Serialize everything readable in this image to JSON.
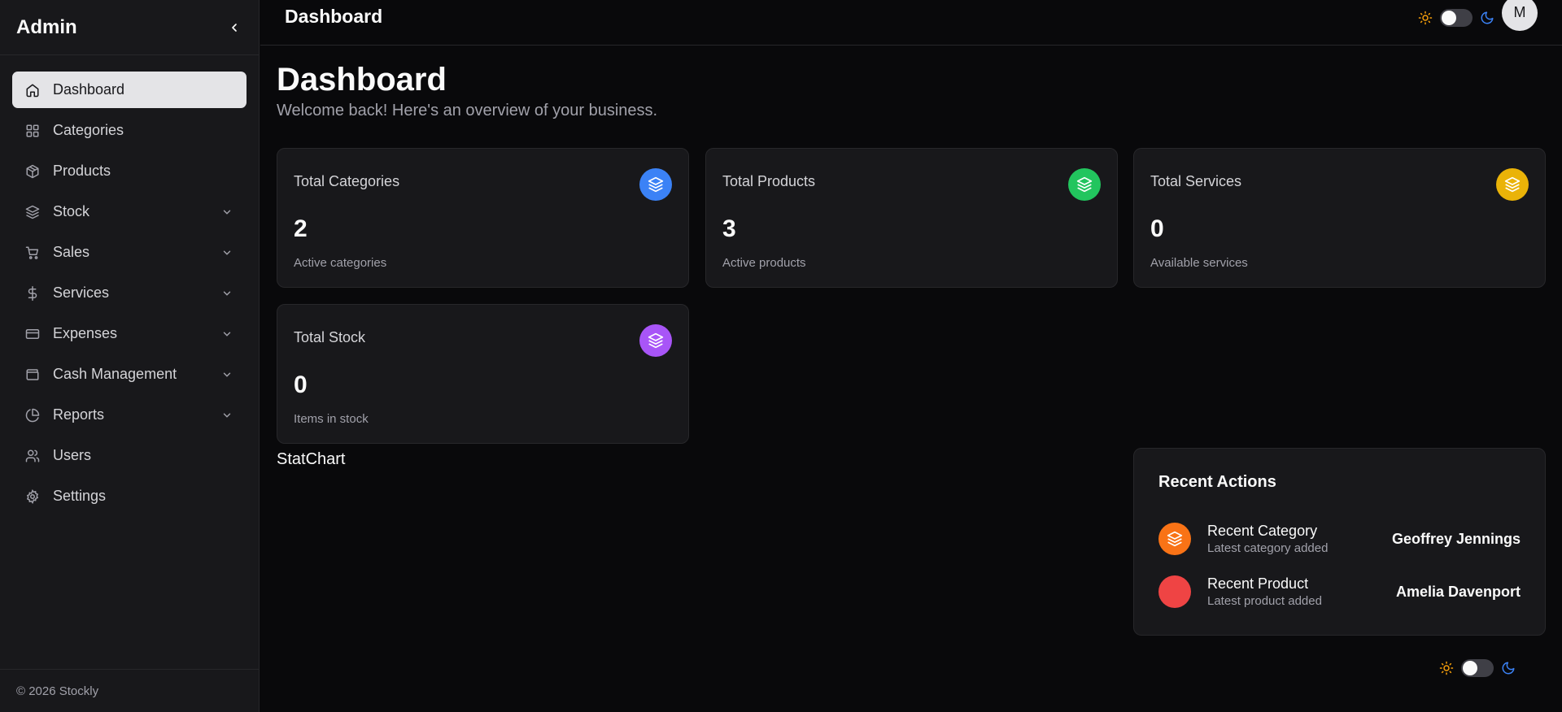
{
  "sidebar": {
    "title": "Admin",
    "items": [
      {
        "label": "Dashboard",
        "icon": "home-icon",
        "active": true,
        "expandable": false
      },
      {
        "label": "Categories",
        "icon": "grid-icon",
        "active": false,
        "expandable": false
      },
      {
        "label": "Products",
        "icon": "package-icon",
        "active": false,
        "expandable": false
      },
      {
        "label": "Stock",
        "icon": "layers-icon",
        "active": false,
        "expandable": true
      },
      {
        "label": "Sales",
        "icon": "cart-icon",
        "active": false,
        "expandable": true
      },
      {
        "label": "Services",
        "icon": "dollar-icon",
        "active": false,
        "expandable": true
      },
      {
        "label": "Expenses",
        "icon": "credit-card-icon",
        "active": false,
        "expandable": true
      },
      {
        "label": "Cash Management",
        "icon": "wallet-icon",
        "active": false,
        "expandable": true
      },
      {
        "label": "Reports",
        "icon": "pie-chart-icon",
        "active": false,
        "expandable": true
      },
      {
        "label": "Users",
        "icon": "users-icon",
        "active": false,
        "expandable": false
      },
      {
        "label": "Settings",
        "icon": "gear-icon",
        "active": false,
        "expandable": false
      }
    ],
    "footer": "© 2026 Stockly"
  },
  "header": {
    "title": "Dashboard",
    "avatar_initial": "M"
  },
  "main": {
    "heading": "Dashboard",
    "subheading": "Welcome back! Here's an overview of your business.",
    "cards": [
      {
        "title": "Total Categories",
        "value": "2",
        "desc": "Active categories",
        "color": "#3b82f6"
      },
      {
        "title": "Total Products",
        "value": "3",
        "desc": "Active products",
        "color": "#22c55e"
      },
      {
        "title": "Total Services",
        "value": "0",
        "desc": "Available services",
        "color": "#eab308"
      },
      {
        "title": "Total Stock",
        "value": "0",
        "desc": "Items in stock",
        "color": "#a855f7"
      }
    ],
    "statchart_label": "StatChart",
    "recent": {
      "title": "Recent Actions",
      "items": [
        {
          "name": "Recent Category",
          "sub": "Latest category added",
          "user": "Geoffrey Jennings",
          "color": "#f97316",
          "icon": "layers-icon"
        },
        {
          "name": "Recent Product",
          "sub": "Latest product added",
          "user": "Amelia Davenport",
          "color": "#ef4444",
          "icon": ""
        }
      ]
    }
  },
  "colors": {
    "accent_sun": "#f59e0b",
    "accent_moon": "#3b82f6"
  }
}
